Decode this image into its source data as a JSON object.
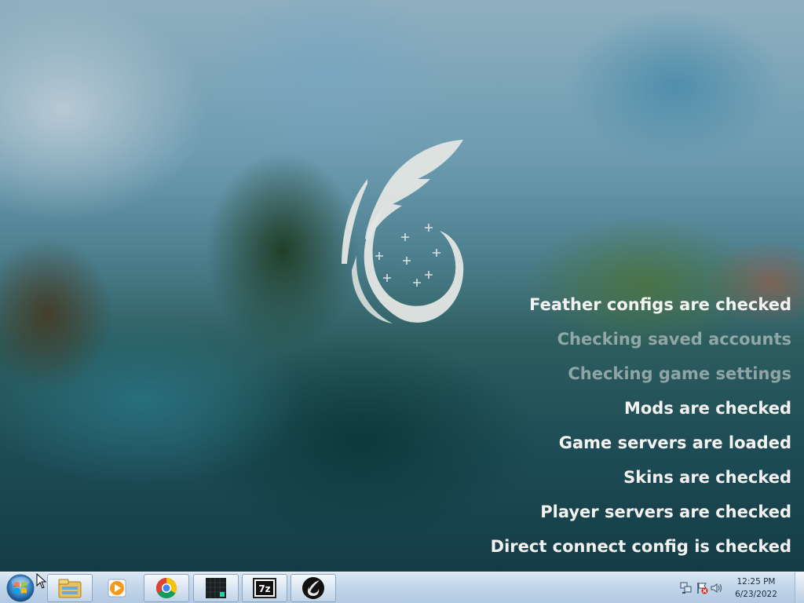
{
  "loader": {
    "statuses": [
      {
        "text": "Feather configs are checked",
        "state": "done"
      },
      {
        "text": "Checking saved accounts",
        "state": "pending"
      },
      {
        "text": "Checking game settings",
        "state": "pending"
      },
      {
        "text": "Mods are checked",
        "state": "done"
      },
      {
        "text": "Game servers are loaded",
        "state": "done"
      },
      {
        "text": "Skins are checked",
        "state": "done"
      },
      {
        "text": "Player servers are checked",
        "state": "done"
      },
      {
        "text": "Direct connect config is checked",
        "state": "done"
      }
    ],
    "logo_icon": "feather-logo-icon"
  },
  "taskbar": {
    "start_icon": "windows-start-orb-icon",
    "apps": [
      {
        "icon": "file-explorer-icon"
      },
      {
        "icon": "media-player-icon"
      },
      {
        "icon": "chrome-icon"
      },
      {
        "icon": "terminal-app-icon"
      },
      {
        "icon": "7zip-icon",
        "label": "7z"
      },
      {
        "icon": "feather-client-icon"
      }
    ],
    "tray": {
      "network_icon": "network-icon",
      "flag_icon": "action-center-flag-icon",
      "volume_icon": "volume-icon",
      "time": "12:25 PM",
      "date": "6/23/2022"
    }
  },
  "colors": {
    "status_done": "#f3f4f2",
    "status_pending": "#cdd4d4"
  }
}
